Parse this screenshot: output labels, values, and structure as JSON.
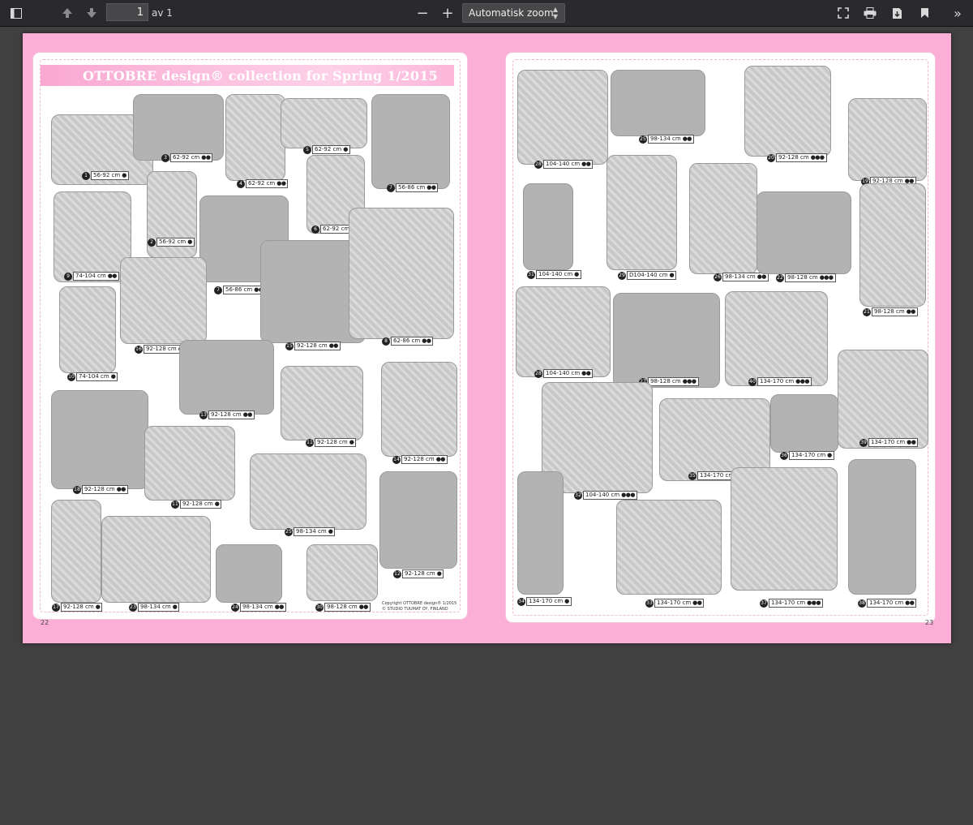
{
  "toolbar": {
    "page_current": "1",
    "page_of": "av 1",
    "zoom_minus": "−",
    "zoom_plus": "+",
    "zoom_value": "Automatisk zoom"
  },
  "document": {
    "title": "OTTOBRE design® collection for Spring 1/2015",
    "copyright_line1": "Copyright OTTOBRE design® 1/2015",
    "copyright_line2": "© STUDIO TUUMAT OY, FINLAND",
    "page_left": "22",
    "page_right": "23"
  },
  "garments_left": [
    {
      "num": "1",
      "size": "56-92 cm",
      "dots": "●"
    },
    {
      "num": "3",
      "size": "62-92 cm",
      "dots": "●●"
    },
    {
      "num": "4",
      "size": "62-92 cm",
      "dots": "●●"
    },
    {
      "num": "5",
      "size": "62-92 cm",
      "dots": "●"
    },
    {
      "num": "7",
      "size": "56-86 cm",
      "dots": "●●"
    },
    {
      "num": "9",
      "size": "74-104 cm",
      "dots": "●●"
    },
    {
      "num": "2",
      "size": "56-92 cm",
      "dots": "●"
    },
    {
      "num": "7",
      "size": "56-86 cm",
      "dots": "●●"
    },
    {
      "num": "6",
      "size": "62-92 cm",
      "dots": "●"
    },
    {
      "num": "16",
      "size": "92-128 cm",
      "dots": "●"
    },
    {
      "num": "15",
      "size": "92-128 cm",
      "dots": "●●"
    },
    {
      "num": "8",
      "size": "62-86 cm",
      "dots": "●●"
    },
    {
      "num": "10",
      "size": "74-104 cm",
      "dots": "●"
    },
    {
      "num": "13",
      "size": "92-128 cm",
      "dots": "●●"
    },
    {
      "num": "11",
      "size": "92-128 cm",
      "dots": "●"
    },
    {
      "num": "14",
      "size": "92-128 cm",
      "dots": "●●"
    },
    {
      "num": "18",
      "size": "92-128 cm",
      "dots": "●●"
    },
    {
      "num": "11",
      "size": "92-128 cm",
      "dots": "●"
    },
    {
      "num": "25",
      "size": "98-134 cm",
      "dots": "●"
    },
    {
      "num": "12",
      "size": "92-128 cm",
      "dots": "●"
    },
    {
      "num": "17",
      "size": "92-128 cm",
      "dots": "●"
    },
    {
      "num": "23",
      "size": "98-134 cm",
      "dots": "●"
    },
    {
      "num": "24",
      "size": "98-134 cm",
      "dots": "●●"
    },
    {
      "num": "30",
      "size": "98-128 cm",
      "dots": "●●"
    }
  ],
  "garments_right": [
    {
      "num": "28",
      "size": "104-140 cm",
      "dots": "●●"
    },
    {
      "num": "25",
      "size": "98-134 cm",
      "dots": "●●"
    },
    {
      "num": "20",
      "size": "92-128 cm",
      "dots": "●●●"
    },
    {
      "num": "19",
      "size": "92-128 cm",
      "dots": "●●"
    },
    {
      "num": "31",
      "size": "104-140 cm",
      "dots": "●"
    },
    {
      "num": "29",
      "size": "D104-140 cm",
      "dots": "●"
    },
    {
      "num": "26",
      "size": "98-134 cm",
      "dots": "●●"
    },
    {
      "num": "22",
      "size": "98-128 cm",
      "dots": "●●●"
    },
    {
      "num": "21",
      "size": "98-128 cm",
      "dots": "●●"
    },
    {
      "num": "28",
      "size": "104-140 cm",
      "dots": "●●"
    },
    {
      "num": "27",
      "size": "98-128 cm",
      "dots": "●●●"
    },
    {
      "num": "40",
      "size": "134-170 cm",
      "dots": "●●●"
    },
    {
      "num": "35",
      "size": "134-170 cm",
      "dots": "●"
    },
    {
      "num": "36",
      "size": "134-170 cm",
      "dots": "●"
    },
    {
      "num": "39",
      "size": "134-170 cm",
      "dots": "●●"
    },
    {
      "num": "32",
      "size": "104-140 cm",
      "dots": "●●●"
    },
    {
      "num": "34",
      "size": "134-170 cm",
      "dots": "●"
    },
    {
      "num": "33",
      "size": "134-170 cm",
      "dots": "●●"
    },
    {
      "num": "37",
      "size": "134-170 cm",
      "dots": "●●●"
    },
    {
      "num": "38",
      "size": "134-170 cm",
      "dots": "●●"
    }
  ]
}
